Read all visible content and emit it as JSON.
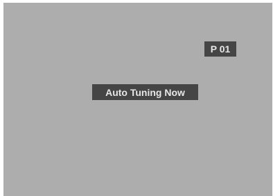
{
  "osd": {
    "channel_label": "P 01",
    "status_message": "Auto Tuning Now"
  },
  "colors": {
    "screen_background": "#adadad",
    "box_background": "#454545",
    "text": "#e7e7e7"
  }
}
